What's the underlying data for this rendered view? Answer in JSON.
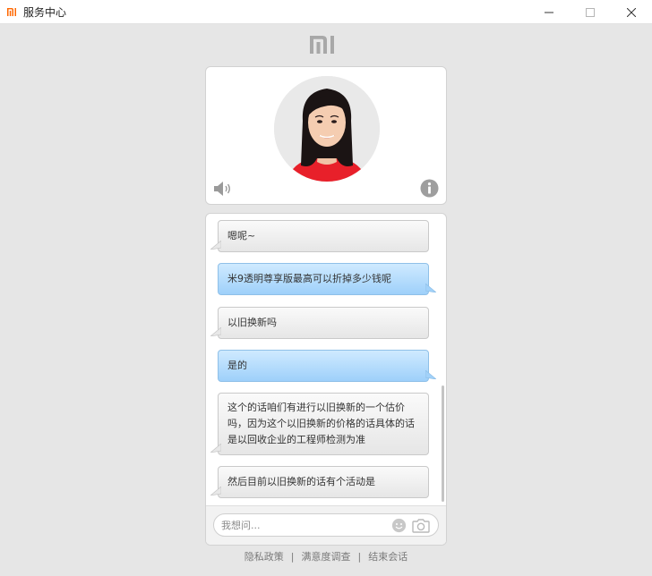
{
  "window": {
    "title": "服务中心",
    "brand_color": "#ff6700"
  },
  "brand": {
    "logo": "mi-logo"
  },
  "agent": {
    "avatar": "agent-avatar",
    "speaker_icon": "speaker-icon",
    "info_icon": "info-icon"
  },
  "messages": [
    {
      "from": "agent",
      "text": "嗯呢~"
    },
    {
      "from": "user",
      "text": "米9透明尊享版最高可以折掉多少钱呢"
    },
    {
      "from": "agent",
      "text": "以旧换新吗"
    },
    {
      "from": "user",
      "text": "是的"
    },
    {
      "from": "agent",
      "lines": [
        "这个的话咱们有进行以旧换新的一个估价",
        "吗，因为这个以旧换新的价格的话具体的话",
        "是以回收企业的工程师检测为准"
      ]
    },
    {
      "from": "agent",
      "text": "然后目前以旧换新的话有个活动是"
    }
  ],
  "input": {
    "placeholder": "我想问..."
  },
  "footer": {
    "links": [
      "隐私政策",
      "满意度调查",
      "结束会话"
    ],
    "separator": "|"
  }
}
